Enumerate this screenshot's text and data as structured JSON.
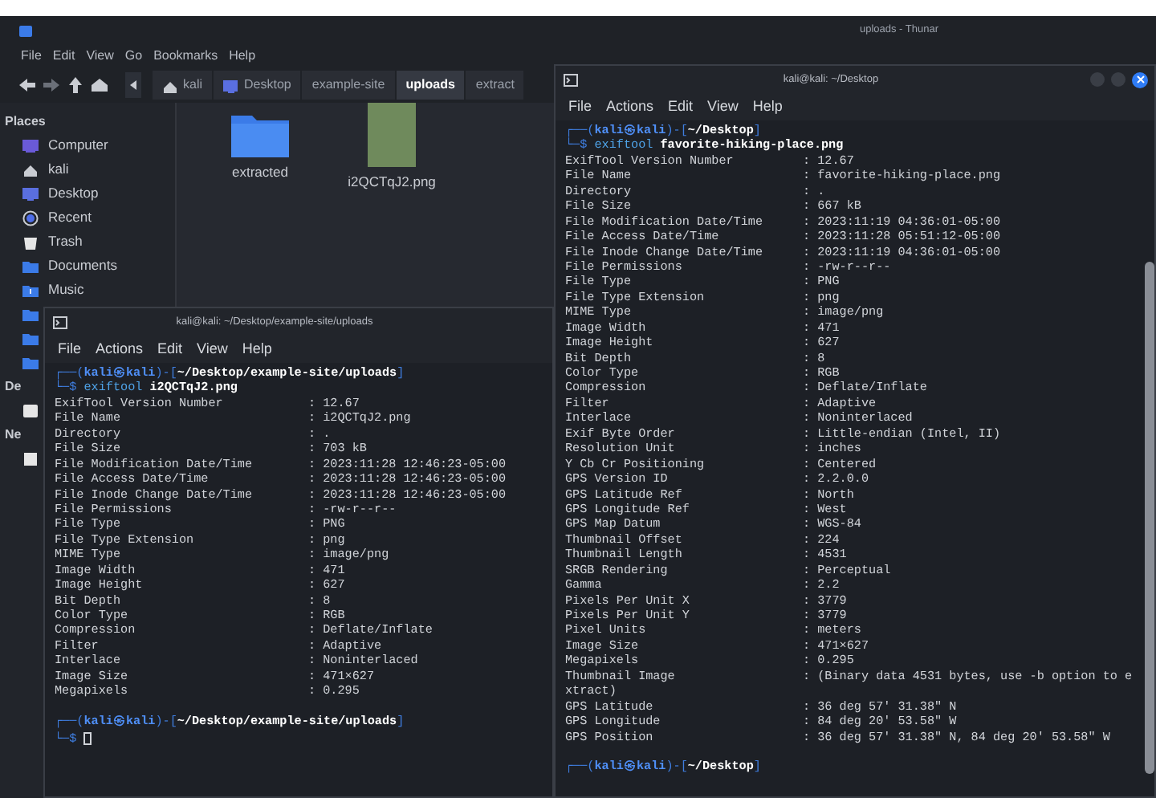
{
  "file_manager": {
    "title": "uploads - Thunar",
    "menu": [
      "File",
      "Edit",
      "View",
      "Go",
      "Bookmarks",
      "Help"
    ],
    "path": [
      {
        "label": "kali",
        "kind": "home",
        "selected": false
      },
      {
        "label": "Desktop",
        "kind": "desktop",
        "selected": false
      },
      {
        "label": "example-site",
        "selected": false
      },
      {
        "label": "uploads",
        "selected": true
      },
      {
        "label": "extract",
        "selected": false
      }
    ],
    "sidebar": [
      {
        "heading": "Places",
        "items": [
          {
            "label": "Computer",
            "kind": "computer"
          },
          {
            "label": "kali",
            "kind": "home"
          },
          {
            "label": "Desktop",
            "kind": "desktop"
          },
          {
            "label": "Recent",
            "kind": "recent"
          },
          {
            "label": "Trash",
            "kind": "trash"
          },
          {
            "label": "Documents",
            "kind": "folder"
          },
          {
            "label": "Music",
            "kind": "music"
          },
          {
            "kind": "folder"
          },
          {
            "kind": "folder"
          },
          {
            "kind": "folder"
          }
        ]
      },
      {
        "heading": "De",
        "items": [
          {
            "kind": "drive"
          }
        ]
      },
      {
        "heading": "Ne",
        "items": [
          {
            "kind": "network"
          }
        ]
      }
    ],
    "files": [
      {
        "name": "extracted",
        "kind": "folder"
      },
      {
        "name": "i2QCTqJ2.png",
        "kind": "image"
      }
    ]
  },
  "terminals": [
    {
      "title": "kali@kali: ~/Desktop/example-site/uploads",
      "menu": [
        "File",
        "Actions",
        "Edit",
        "View",
        "Help"
      ],
      "lines": [
        {
          "kind": "prompt",
          "segments": [
            {
              "kind": "frame",
              "text": "┌──("
            },
            {
              "kind": "user",
              "text": "kali㉿kali"
            },
            {
              "kind": "frame",
              "text": ")-["
            },
            {
              "kind": "path",
              "text": "~/Desktop/example-site/uploads"
            },
            {
              "kind": "frame",
              "text": "]"
            }
          ]
        },
        {
          "kind": "prompt",
          "segments": [
            {
              "kind": "frame",
              "text": "└─$ "
            },
            {
              "kind": "command",
              "text": "exiftool "
            },
            {
              "kind": "argument",
              "text": "i2QCTqJ2.png"
            }
          ]
        },
        {
          "kind": "row",
          "tag": "ExifTool Version Number",
          "value": ": 12.67"
        },
        {
          "kind": "row",
          "tag": "File Name",
          "value": ": i2QCTqJ2.png"
        },
        {
          "kind": "row",
          "tag": "Directory",
          "value": ": ."
        },
        {
          "kind": "row",
          "tag": "File Size",
          "value": ": 703 kB"
        },
        {
          "kind": "row",
          "tag": "File Modification Date/Time",
          "value": ": 2023:11:28 12:46:23-05:00"
        },
        {
          "kind": "row",
          "tag": "File Access Date/Time",
          "value": ": 2023:11:28 12:46:23-05:00"
        },
        {
          "kind": "row",
          "tag": "File Inode Change Date/Time",
          "value": ": 2023:11:28 12:46:23-05:00"
        },
        {
          "kind": "row",
          "tag": "File Permissions",
          "value": ": -rw-r--r--"
        },
        {
          "kind": "row",
          "tag": "File Type",
          "value": ": PNG"
        },
        {
          "kind": "row",
          "tag": "File Type Extension",
          "value": ": png"
        },
        {
          "kind": "row",
          "tag": "MIME Type",
          "value": ": image/png"
        },
        {
          "kind": "row",
          "tag": "Image Width",
          "value": ": 471"
        },
        {
          "kind": "row",
          "tag": "Image Height",
          "value": ": 627"
        },
        {
          "kind": "row",
          "tag": "Bit Depth",
          "value": ": 8"
        },
        {
          "kind": "row",
          "tag": "Color Type",
          "value": ": RGB"
        },
        {
          "kind": "row",
          "tag": "Compression",
          "value": ": Deflate/Inflate"
        },
        {
          "kind": "row",
          "tag": "Filter",
          "value": ": Adaptive"
        },
        {
          "kind": "row",
          "tag": "Interlace",
          "value": ": Noninterlaced"
        },
        {
          "kind": "row",
          "tag": "Image Size",
          "value": ": 471×627"
        },
        {
          "kind": "row",
          "tag": "Megapixels",
          "value": ": 0.295"
        },
        {
          "kind": "blank"
        },
        {
          "kind": "prompt",
          "segments": [
            {
              "kind": "frame",
              "text": "┌──("
            },
            {
              "kind": "user",
              "text": "kali㉿kali"
            },
            {
              "kind": "frame",
              "text": ")-["
            },
            {
              "kind": "path",
              "text": "~/Desktop/example-site/uploads"
            },
            {
              "kind": "frame",
              "text": "]"
            }
          ]
        },
        {
          "kind": "prompt",
          "segments": [
            {
              "kind": "frame",
              "text": "└─$ "
            },
            {
              "kind": "cursor"
            }
          ]
        }
      ]
    },
    {
      "title": "kali@kali: ~/Desktop",
      "menu": [
        "File",
        "Actions",
        "Edit",
        "View",
        "Help"
      ],
      "lines": [
        {
          "kind": "prompt",
          "segments": [
            {
              "kind": "frame",
              "text": "┌──("
            },
            {
              "kind": "user",
              "text": "kali㉿kali"
            },
            {
              "kind": "frame",
              "text": ")-["
            },
            {
              "kind": "path",
              "text": "~/Desktop"
            },
            {
              "kind": "frame",
              "text": "]"
            }
          ]
        },
        {
          "kind": "prompt",
          "segments": [
            {
              "kind": "frame",
              "text": "└─$ "
            },
            {
              "kind": "command",
              "text": "exiftool "
            },
            {
              "kind": "argument",
              "text": "favorite-hiking-place.png"
            }
          ]
        },
        {
          "kind": "row",
          "tag": "ExifTool Version Number",
          "value": ": 12.67"
        },
        {
          "kind": "row",
          "tag": "File Name",
          "value": ": favorite-hiking-place.png"
        },
        {
          "kind": "row",
          "tag": "Directory",
          "value": ": ."
        },
        {
          "kind": "row",
          "tag": "File Size",
          "value": ": 667 kB"
        },
        {
          "kind": "row",
          "tag": "File Modification Date/Time",
          "value": ": 2023:11:19 04:36:01-05:00"
        },
        {
          "kind": "row",
          "tag": "File Access Date/Time",
          "value": ": 2023:11:28 05:51:12-05:00"
        },
        {
          "kind": "row",
          "tag": "File Inode Change Date/Time",
          "value": ": 2023:11:19 04:36:01-05:00"
        },
        {
          "kind": "row",
          "tag": "File Permissions",
          "value": ": -rw-r--r--"
        },
        {
          "kind": "row",
          "tag": "File Type",
          "value": ": PNG"
        },
        {
          "kind": "row",
          "tag": "File Type Extension",
          "value": ": png"
        },
        {
          "kind": "row",
          "tag": "MIME Type",
          "value": ": image/png"
        },
        {
          "kind": "row",
          "tag": "Image Width",
          "value": ": 471"
        },
        {
          "kind": "row",
          "tag": "Image Height",
          "value": ": 627"
        },
        {
          "kind": "row",
          "tag": "Bit Depth",
          "value": ": 8"
        },
        {
          "kind": "row",
          "tag": "Color Type",
          "value": ": RGB"
        },
        {
          "kind": "row",
          "tag": "Compression",
          "value": ": Deflate/Inflate"
        },
        {
          "kind": "row",
          "tag": "Filter",
          "value": ": Adaptive"
        },
        {
          "kind": "row",
          "tag": "Interlace",
          "value": ": Noninterlaced"
        },
        {
          "kind": "row",
          "tag": "Exif Byte Order",
          "value": ": Little-endian (Intel, II)"
        },
        {
          "kind": "row",
          "tag": "Resolution Unit",
          "value": ": inches"
        },
        {
          "kind": "row",
          "tag": "Y Cb Cr Positioning",
          "value": ": Centered"
        },
        {
          "kind": "row",
          "tag": "GPS Version ID",
          "value": ": 2.2.0.0"
        },
        {
          "kind": "row",
          "tag": "GPS Latitude Ref",
          "value": ": North"
        },
        {
          "kind": "row",
          "tag": "GPS Longitude Ref",
          "value": ": West"
        },
        {
          "kind": "row",
          "tag": "GPS Map Datum",
          "value": ": WGS-84"
        },
        {
          "kind": "row",
          "tag": "Thumbnail Offset",
          "value": ": 224"
        },
        {
          "kind": "row",
          "tag": "Thumbnail Length",
          "value": ": 4531"
        },
        {
          "kind": "row",
          "tag": "SRGB Rendering",
          "value": ": Perceptual"
        },
        {
          "kind": "row",
          "tag": "Gamma",
          "value": ": 2.2"
        },
        {
          "kind": "row",
          "tag": "Pixels Per Unit X",
          "value": ": 3779"
        },
        {
          "kind": "row",
          "tag": "Pixels Per Unit Y",
          "value": ": 3779"
        },
        {
          "kind": "row",
          "tag": "Pixel Units",
          "value": ": meters"
        },
        {
          "kind": "row",
          "tag": "Image Size",
          "value": ": 471×627"
        },
        {
          "kind": "row",
          "tag": "Megapixels",
          "value": ": 0.295"
        },
        {
          "kind": "row",
          "tag": "Thumbnail Image",
          "value": ": (Binary data 4531 bytes, use -b option to e"
        },
        {
          "kind": "wrap",
          "text": "xtract)"
        },
        {
          "kind": "row",
          "tag": "GPS Latitude",
          "value": ": 36 deg 57' 31.38\" N"
        },
        {
          "kind": "row",
          "tag": "GPS Longitude",
          "value": ": 84 deg 20' 53.58\" W"
        },
        {
          "kind": "row",
          "tag": "GPS Position",
          "value": ": 36 deg 57' 31.38\" N, 84 deg 20' 53.58\" W"
        },
        {
          "kind": "blank"
        },
        {
          "kind": "prompt",
          "segments": [
            {
              "kind": "frame",
              "text": "┌──("
            },
            {
              "kind": "user",
              "text": "kali㉿kali"
            },
            {
              "kind": "frame",
              "text": ")-["
            },
            {
              "kind": "path",
              "text": "~/Desktop"
            },
            {
              "kind": "frame",
              "text": "]"
            }
          ]
        }
      ]
    }
  ]
}
